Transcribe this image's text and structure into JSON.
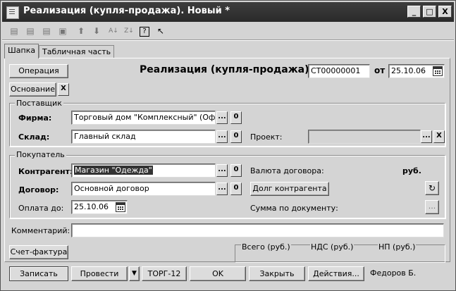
{
  "window": {
    "title": "Реализация (купля-продажа). Новый *",
    "controls": {
      "minimize": "_",
      "maximize": "□",
      "close": "X"
    }
  },
  "toolbar": {
    "tools": [
      "add-row",
      "add-copy-row",
      "delete-row",
      "edit-row",
      "move-up",
      "move-down",
      "sort-asc",
      "sort-desc",
      "help",
      "whats-this"
    ]
  },
  "tabs": [
    {
      "label": "Шапка",
      "active": true
    },
    {
      "label": "Табличная часть",
      "active": false
    }
  ],
  "header": {
    "operation_button": "Операция",
    "basis_button": "Основание",
    "basis_clear": "X",
    "doc_title": "Реализация (купля-продажа) №",
    "doc_number": "СТ00000001",
    "date_label": "от",
    "doc_date": "25.10.06"
  },
  "supplier": {
    "legend": "Поставщик",
    "firm_label": "Фирма:",
    "firm_value": "Торговый дом \"Комплексный\" (Офис)",
    "warehouse_label": "Склад:",
    "warehouse_value": "Главный склад",
    "project_label": "Проект:",
    "project_value": ""
  },
  "buyer": {
    "legend": "Покупатель",
    "counterparty_label": "Контрагент:",
    "counterparty_value": "Магазин \"Одежда\"",
    "contract_label": "Договор:",
    "contract_value": "Основной договор",
    "payment_label": "Оплата до:",
    "payment_value": "25.10.06",
    "currency_label": "Валюта договора:",
    "currency_value": "руб.",
    "debt_button": "Долг контрагента",
    "sum_label": "Сумма по документу:",
    "sum_button": "..."
  },
  "footer": {
    "comment_label": "Комментарий:",
    "comment_value": "",
    "invoice_button": "Счет-фактура",
    "total_label": "Всего (руб.)",
    "vat_label": "НДС (руб.)",
    "np_label": "НП (руб.)"
  },
  "actions": {
    "save": "Записать",
    "post": "Провести",
    "print": "ТОРГ-12",
    "ok": "OK",
    "close": "Закрыть",
    "more": "Действия...",
    "author": "Федоров Б."
  },
  "common": {
    "select_glyph": "...",
    "open_glyph": "0",
    "clear_glyph": "X"
  }
}
